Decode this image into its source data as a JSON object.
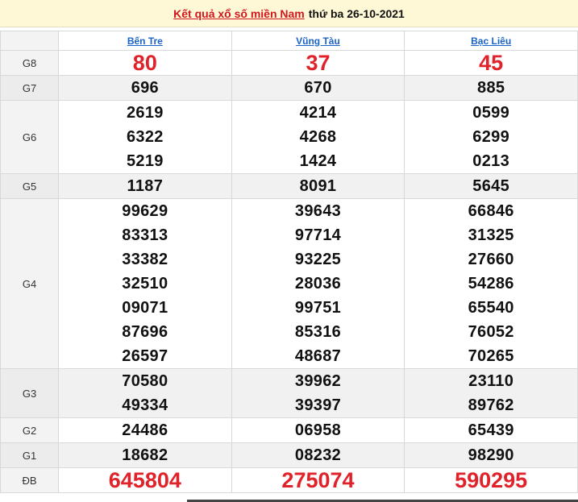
{
  "header": {
    "title_link": "Kết quả xổ số miền Nam",
    "title_date": "thứ ba 26-10-2021"
  },
  "provinces": [
    "Bến Tre",
    "Vũng Tàu",
    "Bạc Liêu"
  ],
  "prizes": {
    "G8": {
      "label": "G8",
      "values": [
        [
          "80"
        ],
        [
          "37"
        ],
        [
          "45"
        ]
      ]
    },
    "G7": {
      "label": "G7",
      "values": [
        [
          "696"
        ],
        [
          "670"
        ],
        [
          "885"
        ]
      ]
    },
    "G6": {
      "label": "G6",
      "values": [
        [
          "2619",
          "6322",
          "5219"
        ],
        [
          "4214",
          "4268",
          "1424"
        ],
        [
          "0599",
          "6299",
          "0213"
        ]
      ]
    },
    "G5": {
      "label": "G5",
      "values": [
        [
          "1187"
        ],
        [
          "8091"
        ],
        [
          "5645"
        ]
      ]
    },
    "G4": {
      "label": "G4",
      "values": [
        [
          "99629",
          "83313",
          "33382",
          "32510",
          "09071",
          "87696",
          "26597"
        ],
        [
          "39643",
          "97714",
          "93225",
          "28036",
          "99751",
          "85316",
          "48687"
        ],
        [
          "66846",
          "31325",
          "27660",
          "54286",
          "65540",
          "76052",
          "70265"
        ]
      ]
    },
    "G3": {
      "label": "G3",
      "values": [
        [
          "70580",
          "49334"
        ],
        [
          "39962",
          "39397"
        ],
        [
          "23110",
          "89762"
        ]
      ]
    },
    "G2": {
      "label": "G2",
      "values": [
        [
          "24486"
        ],
        [
          "06958"
        ],
        [
          "65439"
        ]
      ]
    },
    "G1": {
      "label": "G1",
      "values": [
        [
          "18682"
        ],
        [
          "08232"
        ],
        [
          "98290"
        ]
      ]
    },
    "DB": {
      "label": "ĐB",
      "values": [
        [
          "645804"
        ],
        [
          "275074"
        ],
        [
          "590295"
        ]
      ]
    }
  }
}
